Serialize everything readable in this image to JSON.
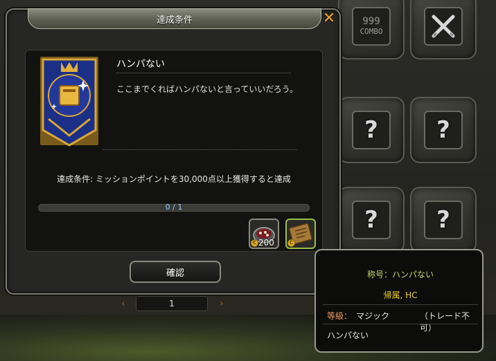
{
  "dialog": {
    "title": "達成条件",
    "close_icon": "close-icon",
    "achievement": {
      "name": "ハンパない",
      "description": "ここまでくればハンパないと言っていいだろう。",
      "emblem_icon": "book-emblem-icon"
    },
    "condition": "達成条件: ミッションポイントを30,000点以上獲得すると達成",
    "progress": {
      "text": "0 / 1",
      "current": 0,
      "total": 1,
      "fill_color": "#3a8ad0"
    },
    "rewards": [
      {
        "icon": "food-dish-icon",
        "count": "200",
        "currency_icon": "coin-icon"
      },
      {
        "icon": "scroll-map-icon",
        "currency_icon": "coin-icon",
        "selected": true
      }
    ],
    "confirm_label": "確認"
  },
  "pager": {
    "page": "1"
  },
  "background": {
    "combo_tile_text": "999",
    "combo_tile_label": "COMBO",
    "tile_question": "?"
  },
  "tooltip": {
    "title": "称号：ハンパない",
    "subtitle": "帰属, HC",
    "grade_label": "等級：",
    "grade_value": "マジック",
    "trade": "（トレード不可）",
    "description": "ハンパない"
  }
}
